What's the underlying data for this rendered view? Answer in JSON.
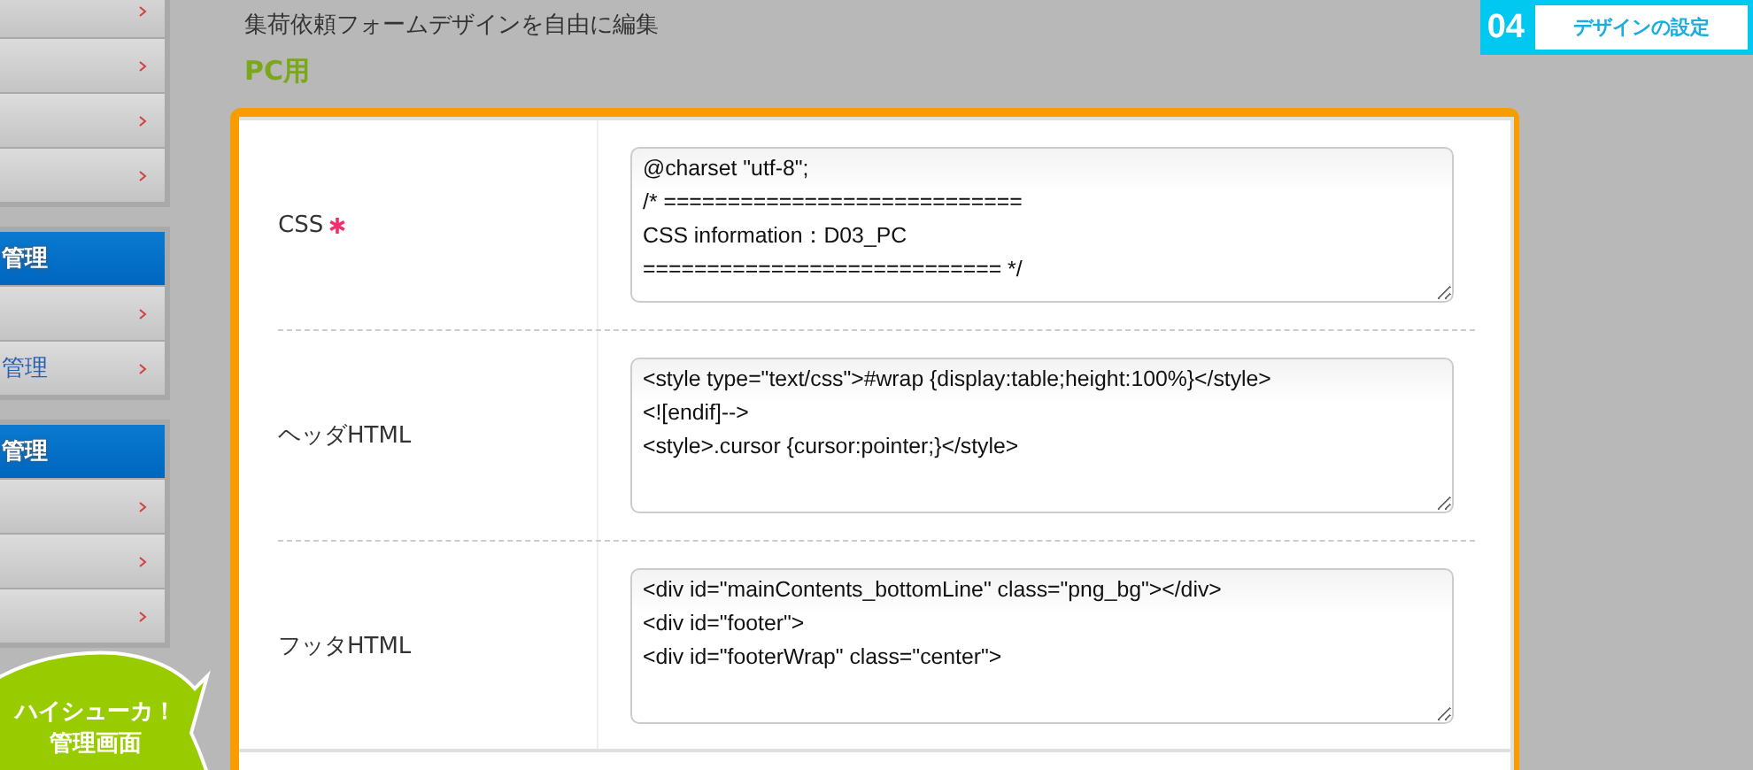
{
  "sidebar": {
    "groups": [
      {
        "items": [
          {
            "kind": "link"
          },
          {
            "kind": "link"
          },
          {
            "kind": "link"
          },
          {
            "kind": "link"
          }
        ]
      },
      {
        "header": "管理",
        "items": [
          {
            "kind": "link"
          },
          {
            "kind": "link",
            "label": "管理"
          }
        ]
      },
      {
        "header": "管理",
        "items": [
          {
            "kind": "link"
          },
          {
            "kind": "link"
          },
          {
            "kind": "link"
          }
        ]
      }
    ]
  },
  "bubble": {
    "lines": [
      "ハイシューカ！",
      "管理画面"
    ]
  },
  "page": {
    "description": "集荷依頼フォームデザインを自由に編集",
    "title": "PC用"
  },
  "step_badge": {
    "number": "04",
    "label": "デザインの設定"
  },
  "form": {
    "rows": [
      {
        "label": "CSS",
        "required": true,
        "value": "@charset \"utf-8\";\n/* ============================\nCSS information：D03_PC\n============================ */"
      },
      {
        "label": "ヘッダHTML",
        "required": false,
        "value": "<style type=\"text/css\">#wrap {display:table;height:100%}</style>\n<![endif]-->\n<style>.cursor {cursor:pointer;}</style>"
      },
      {
        "label": "フッタHTML",
        "required": false,
        "value": "<div id=\"mainContents_bottomLine\" class=\"png_bg\"></div>\n<div id=\"footer\">\n<div id=\"footerWrap\" class=\"center\">"
      }
    ]
  }
}
